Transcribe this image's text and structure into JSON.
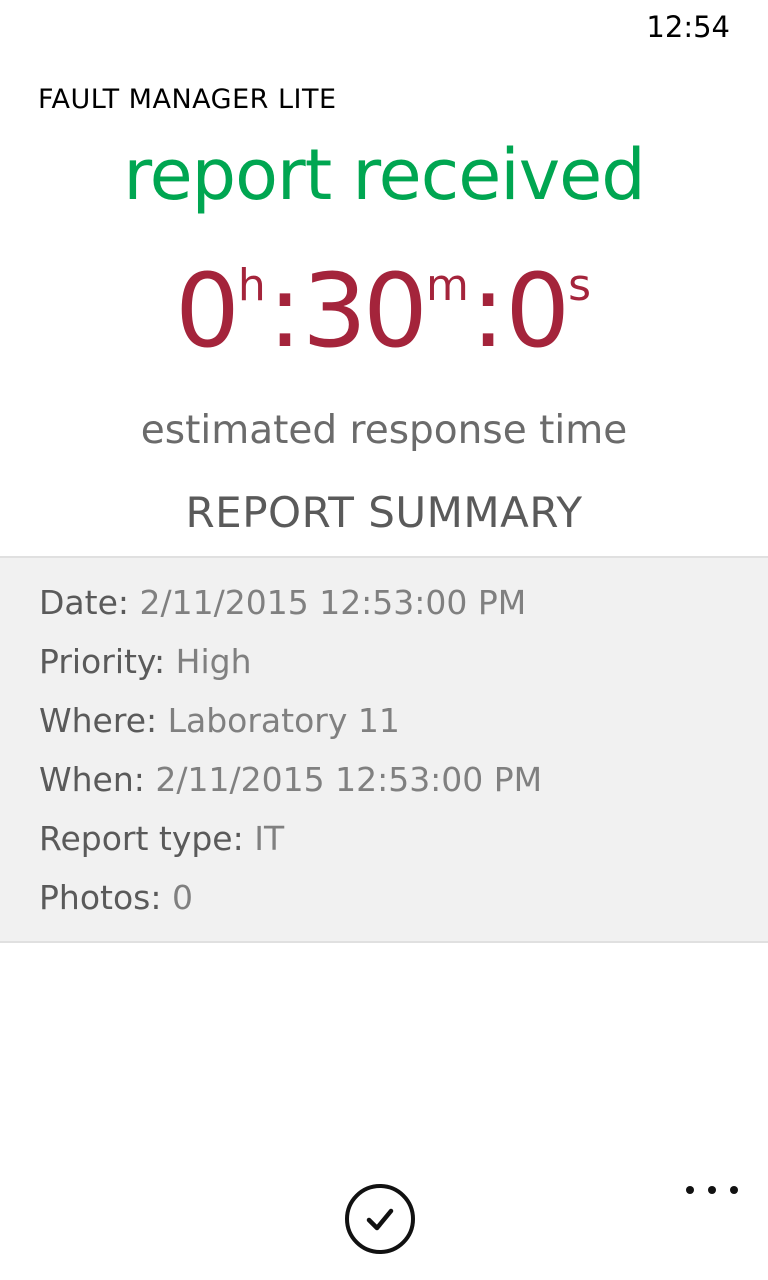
{
  "status_bar": {
    "time": "12:54"
  },
  "app": {
    "title": "FAULT MANAGER LITE"
  },
  "status": {
    "heading": "report received",
    "color": "#00A651"
  },
  "response_timer": {
    "hours": "0",
    "hours_unit": "h",
    "minutes": "30",
    "minutes_unit": "m",
    "seconds": "0",
    "seconds_unit": "s",
    "separator": ":",
    "caption": "estimated response time",
    "color": "#A4243B"
  },
  "summary": {
    "heading": "REPORT SUMMARY",
    "rows": [
      {
        "label": "Date:",
        "value": "2/11/2015 12:53:00 PM"
      },
      {
        "label": "Priority:",
        "value": "High"
      },
      {
        "label": "Where:",
        "value": "Laboratory 11"
      },
      {
        "label": "When:",
        "value": "2/11/2015 12:53:00 PM"
      },
      {
        "label": "Report type:",
        "value": "IT"
      },
      {
        "label": "Photos:",
        "value": "0"
      }
    ]
  },
  "app_bar": {
    "confirm_icon": "check-icon",
    "more_icon": "more-icon"
  }
}
